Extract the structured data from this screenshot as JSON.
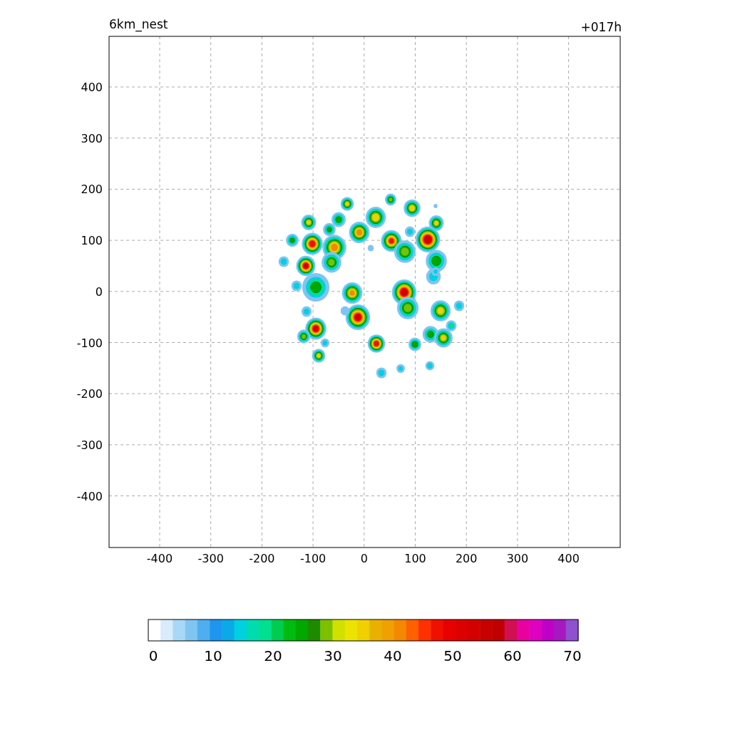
{
  "title": "6km_nest",
  "forecast_hour": "+017h",
  "plot": {
    "x_ticks": [
      "-400",
      "-300",
      "-200",
      "-100",
      "0",
      "100",
      "200",
      "300",
      "400"
    ],
    "y_ticks": [
      "400",
      "300",
      "200",
      "100",
      "0",
      "-100",
      "-200",
      "-300",
      "-400"
    ]
  },
  "colorbar": {
    "ticks": [
      "0",
      "10",
      "20",
      "30",
      "40",
      "50",
      "60",
      "70"
    ],
    "colors": [
      {
        "color": "#ffffff"
      },
      {
        "color": "#d8ecfb"
      },
      {
        "color": "#a8d8f8"
      },
      {
        "color": "#80c4f2"
      },
      {
        "color": "#4eaef0"
      },
      {
        "color": "#1e96f0"
      },
      {
        "color": "#0aaae8"
      },
      {
        "color": "#00d0e0"
      },
      {
        "color": "#00dcb0"
      },
      {
        "color": "#00e090"
      },
      {
        "color": "#00cc50"
      },
      {
        "color": "#00bb10"
      },
      {
        "color": "#00a800"
      },
      {
        "color": "#1e8a00"
      },
      {
        "color": "#7cc000"
      },
      {
        "color": "#d0e000"
      },
      {
        "color": "#ece400"
      },
      {
        "color": "#f0d000"
      },
      {
        "color": "#eab000"
      },
      {
        "color": "#f0a000"
      },
      {
        "color": "#f48800"
      },
      {
        "color": "#ff6000"
      },
      {
        "color": "#ff3000"
      },
      {
        "color": "#f01000"
      },
      {
        "color": "#e80000"
      },
      {
        "color": "#dc0000"
      },
      {
        "color": "#d40000"
      },
      {
        "color": "#c80000"
      },
      {
        "color": "#c00000"
      },
      {
        "color": "#d01050"
      },
      {
        "color": "#e800a0"
      },
      {
        "color": "#e000c0"
      },
      {
        "color": "#c000c8"
      },
      {
        "color": "#a818c0"
      },
      {
        "color": "#9050d0"
      }
    ]
  }
}
